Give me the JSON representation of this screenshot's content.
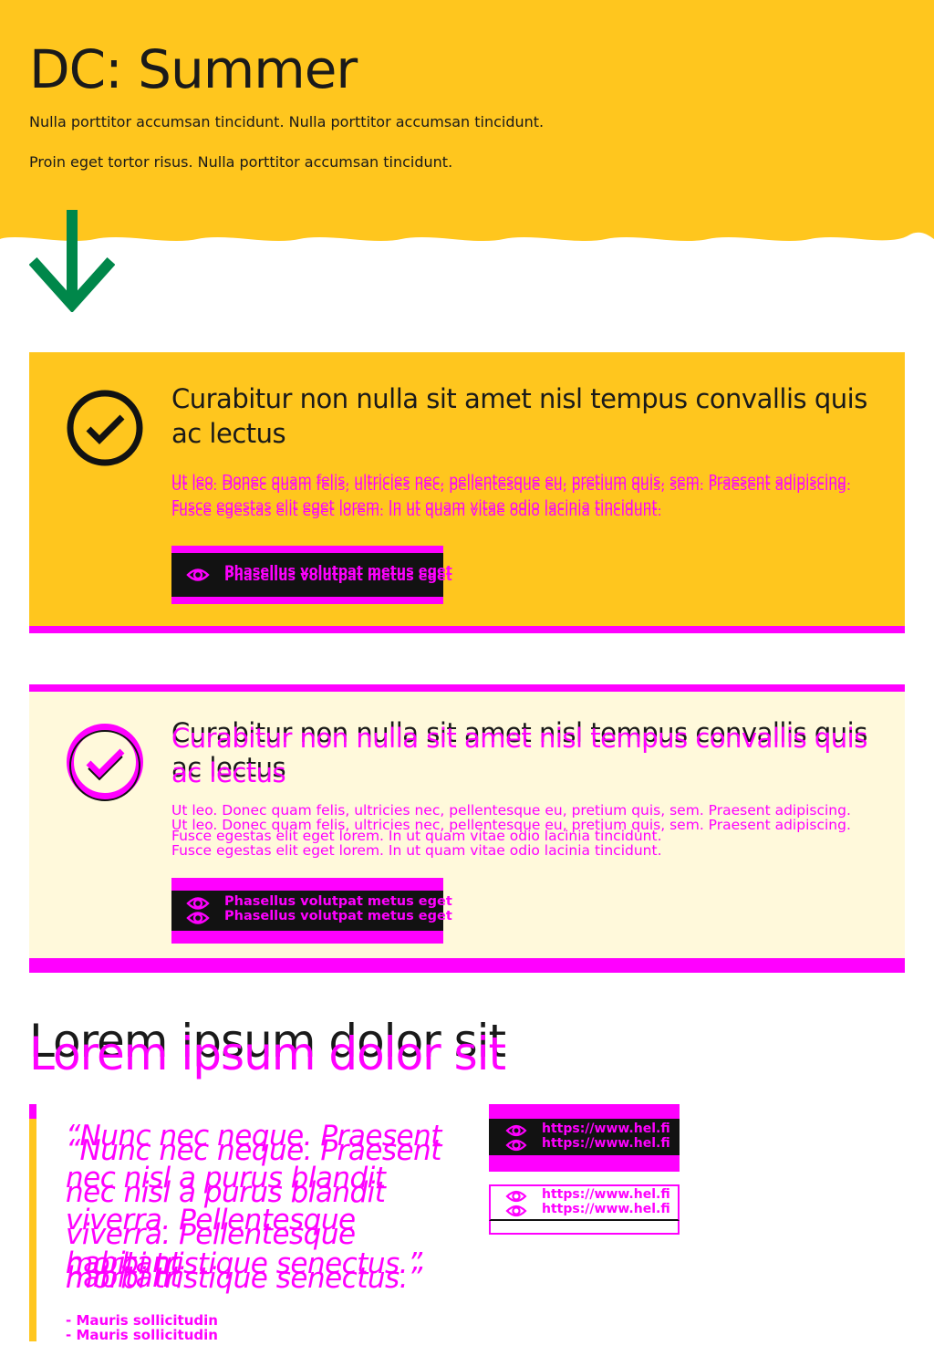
{
  "hero": {
    "title": "DC: Summer",
    "paragraph_1": "Nulla porttitor accumsan tincidunt. Nulla porttitor accumsan tincidunt.",
    "paragraph_2": "Proin eget tortor risus. Nulla porttitor accumsan tincidunt."
  },
  "colors": {
    "summer_yellow": "#ffc61e",
    "light_yellow": "#fff9db",
    "arrow_green": "#00874a",
    "debug_magenta": "#ff00ff",
    "black": "#121212"
  },
  "card_1": {
    "icon": "check-circle-icon",
    "title": "Curabitur non nulla sit amet nisl tempus convallis quis ac lectus",
    "text_line_1": "Ut leo. Donec quam felis, ultricies nec, pellentesque eu, pretium quis, sem. Praesent adipiscing.",
    "text_line_2": "Fusce egestas elit eget lorem. In ut quam vitae odio lacinia tincidunt.",
    "button_label": "Phasellus volutpat metus eget",
    "button_icon": "eye-icon"
  },
  "card_2": {
    "icon": "check-circle-icon",
    "title": "Curabitur non nulla sit amet nisl tempus convallis quis ac lectus",
    "text_line_1": "Ut leo. Donec quam felis, ultricies nec, pellentesque eu, pretium quis, sem. Praesent adipiscing.",
    "text_line_2": "Fusce egestas elit eget lorem. In ut quam vitae odio lacinia tincidunt.",
    "button_label": "Phasellus volutpat metus eget",
    "button_icon": "eye-icon"
  },
  "section": {
    "title": "Lorem ipsum dolor sit"
  },
  "quote": {
    "line_1": "“Nunc nec neque. Praesent",
    "line_2": "nec nisl a purus blandit",
    "line_3": "viverra. Pellentesque habitant",
    "line_4": "morbi tristique senectus.”",
    "citation": "- Mauris sollicitudin"
  },
  "links": {
    "primary_label": "https://www.hel.fi",
    "secondary_label": "https://www.hel.fi",
    "icon": "eye-icon"
  }
}
